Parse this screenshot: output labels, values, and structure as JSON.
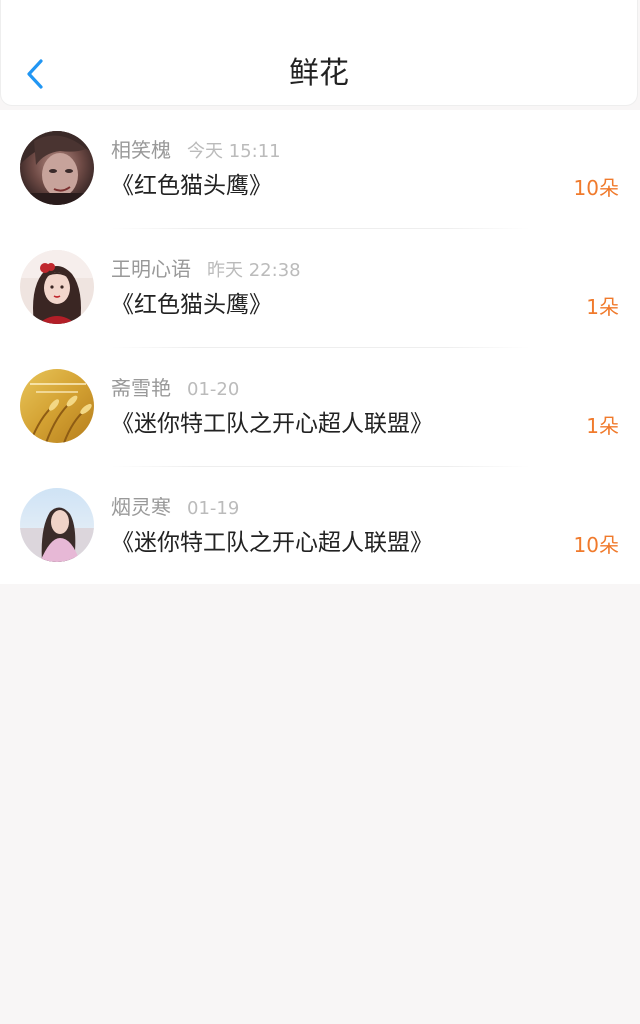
{
  "header": {
    "title": "鲜花",
    "back_icon": "chevron-left-icon",
    "accent_color": "#2196f3"
  },
  "records": [
    {
      "name": "相笑槐",
      "time": "今天 15:11",
      "book": "《红色猫头鹰》",
      "count": "10朵",
      "avatar": "dark-haired-man-portrait"
    },
    {
      "name": "王明心语",
      "time": "昨天 22:38",
      "book": "《红色猫头鹰》",
      "count": "1朵",
      "avatar": "girl-with-red-bow-portrait"
    },
    {
      "name": "斋雪艳",
      "time": "01-20",
      "book": "《迷你特工队之开心超人联盟》",
      "count": "1朵",
      "avatar": "golden-wheat-field"
    },
    {
      "name": "烟灵寒",
      "time": "01-19",
      "book": "《迷你特工队之开心超人联盟》",
      "count": "10朵",
      "avatar": "girl-outdoors-portrait"
    }
  ],
  "colors": {
    "count_text": "#f07a2c",
    "name_text": "#999999",
    "time_text": "#bbbbbb",
    "book_text": "#222222"
  }
}
